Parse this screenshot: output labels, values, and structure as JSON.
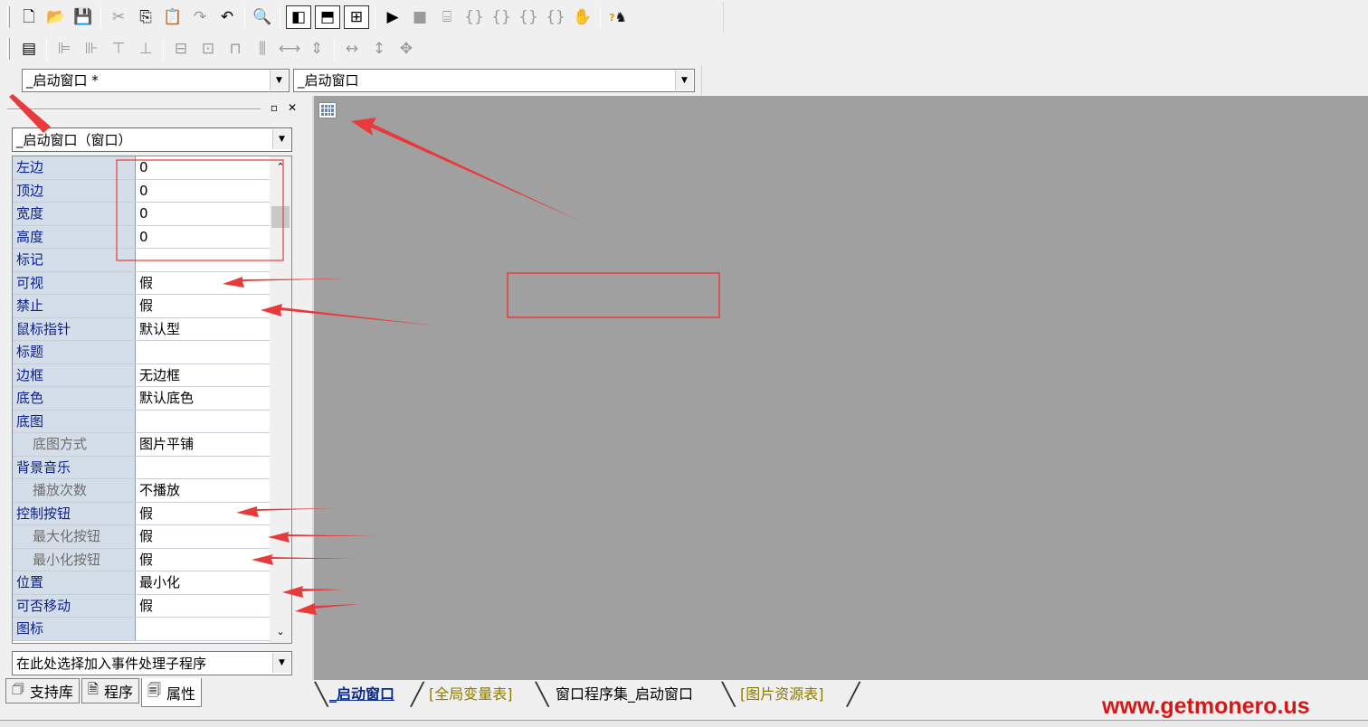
{
  "toolbar_main": {
    "icons": [
      "new-file-icon",
      "open-folder-icon",
      "save-icon",
      "cut-icon",
      "copy-icon",
      "paste-icon",
      "redo-icon",
      "undo-icon",
      "find-icon",
      "layout-left-icon",
      "layout-top-icon",
      "layout-split-icon",
      "run-icon",
      "stop-icon",
      "step-icon",
      "step-into-icon",
      "step-over-icon",
      "step-out-icon",
      "run-to-cursor-icon",
      "hand-icon",
      "help-icon"
    ]
  },
  "toolbar_align": {
    "icons": [
      "form-icon",
      "align-left-icon",
      "align-right-icon",
      "align-top-icon",
      "align-bottom-icon",
      "center-horizontal-icon",
      "center-vertical-icon",
      "same-width-icon",
      "same-height-icon",
      "space-horizontal-icon",
      "space-vertical-icon",
      "stretch-width-icon",
      "stretch-height-icon",
      "stretch-both-icon"
    ]
  },
  "combos": {
    "window_selector": "_启动窗口 *",
    "event_target": "_启动窗口"
  },
  "property_panel": {
    "object_selector": "_启动窗口（窗口）",
    "properties": [
      {
        "name": "左边",
        "value": "0",
        "child": false
      },
      {
        "name": "顶边",
        "value": "0",
        "child": false
      },
      {
        "name": "宽度",
        "value": "0",
        "child": false
      },
      {
        "name": "高度",
        "value": "0",
        "child": false
      },
      {
        "name": "标记",
        "value": "",
        "child": false
      },
      {
        "name": "可视",
        "value": "假",
        "child": false
      },
      {
        "name": "禁止",
        "value": "假",
        "child": false
      },
      {
        "name": "鼠标指针",
        "value": "默认型",
        "child": false
      },
      {
        "name": "标题",
        "value": "",
        "child": false
      },
      {
        "name": "边框",
        "value": "无边框",
        "child": false
      },
      {
        "name": "底色",
        "value": "默认底色",
        "child": false
      },
      {
        "name": "底图",
        "value": "",
        "child": false
      },
      {
        "name": "底图方式",
        "value": "图片平铺",
        "child": true
      },
      {
        "name": "背景音乐",
        "value": "",
        "child": false
      },
      {
        "name": "播放次数",
        "value": "不播放",
        "child": true
      },
      {
        "name": "控制按钮",
        "value": "假",
        "child": false
      },
      {
        "name": "最大化按钮",
        "value": "假",
        "child": true
      },
      {
        "name": "最小化按钮",
        "value": "假",
        "child": true
      },
      {
        "name": "位置",
        "value": "最小化",
        "child": false
      },
      {
        "name": "可否移动",
        "value": "假",
        "child": false
      },
      {
        "name": "图标",
        "value": "",
        "child": false
      }
    ],
    "event_handler_selector": "在此处选择加入事件处理子程序"
  },
  "left_tabs": [
    {
      "label": "支持库",
      "icon": "library-icon",
      "active": false
    },
    {
      "label": "程序",
      "icon": "program-icon",
      "active": false
    },
    {
      "label": "属性",
      "icon": "properties-icon",
      "active": true
    }
  ],
  "doc_tabs": [
    {
      "label": "_启动窗口",
      "active": true
    },
    {
      "label": "[全局变量表]",
      "active": false
    },
    {
      "label": "窗口程序集_启动窗口",
      "active": false
    },
    {
      "label": "[图片资源表]",
      "active": false
    }
  ],
  "watermark": "www.getmonero.us",
  "colors": {
    "designer_bg": "#a0a0a0",
    "prop_name_bg": "#d4dee8",
    "prop_name_text": "#0a1e8c",
    "annotation_red": "#e83a3a",
    "watermark_red": "#d41818"
  }
}
